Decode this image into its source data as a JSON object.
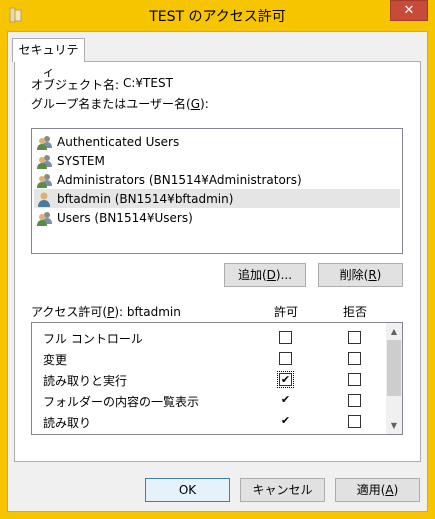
{
  "window": {
    "title": "TEST のアクセス許可",
    "close_label": "✕"
  },
  "tabs": [
    {
      "label": "セキュリティ"
    }
  ],
  "object": {
    "label": "オブジェクト名:",
    "value": "C:¥TEST"
  },
  "group_label": {
    "prefix": "グループ名またはユーザー名(",
    "key": "G",
    "suffix": "):"
  },
  "users": [
    {
      "name": "Authenticated Users",
      "icon": "users-group-icon",
      "selected": false
    },
    {
      "name": "SYSTEM",
      "icon": "users-group-icon",
      "selected": false
    },
    {
      "name": "Administrators (BN1514¥Administrators)",
      "icon": "users-group-icon",
      "selected": false
    },
    {
      "name": "bftadmin (BN1514¥bftadmin)",
      "icon": "user-icon",
      "selected": true
    },
    {
      "name": "Users (BN1514¥Users)",
      "icon": "users-group-icon",
      "selected": false
    }
  ],
  "buttons": {
    "add": {
      "prefix": "追加(",
      "key": "D",
      "suffix": ")..."
    },
    "remove": {
      "prefix": "削除(",
      "key": "R",
      "suffix": ")"
    },
    "ok": "OK",
    "cancel": "キャンセル",
    "apply": {
      "prefix": "適用(",
      "key": "A",
      "suffix": ")"
    }
  },
  "permissions_header": {
    "prefix": "アクセス許可(",
    "key": "P",
    "suffix": "): bftadmin",
    "allow": "許可",
    "deny": "拒否"
  },
  "permissions": [
    {
      "name": "フル コントロール",
      "allow": false,
      "deny": false
    },
    {
      "name": "変更",
      "allow": false,
      "deny": false
    },
    {
      "name": "読み取りと実行",
      "allow": true,
      "deny": false,
      "focused": true
    },
    {
      "name": "フォルダーの内容の一覧表示",
      "allow": true,
      "deny": false
    },
    {
      "name": "読み取り",
      "allow": true,
      "deny": false
    }
  ],
  "check_mark": "✔",
  "colors": {
    "titlebar": "#f7c400",
    "close": "#c74a3a",
    "selection": "#e5e5e5"
  }
}
